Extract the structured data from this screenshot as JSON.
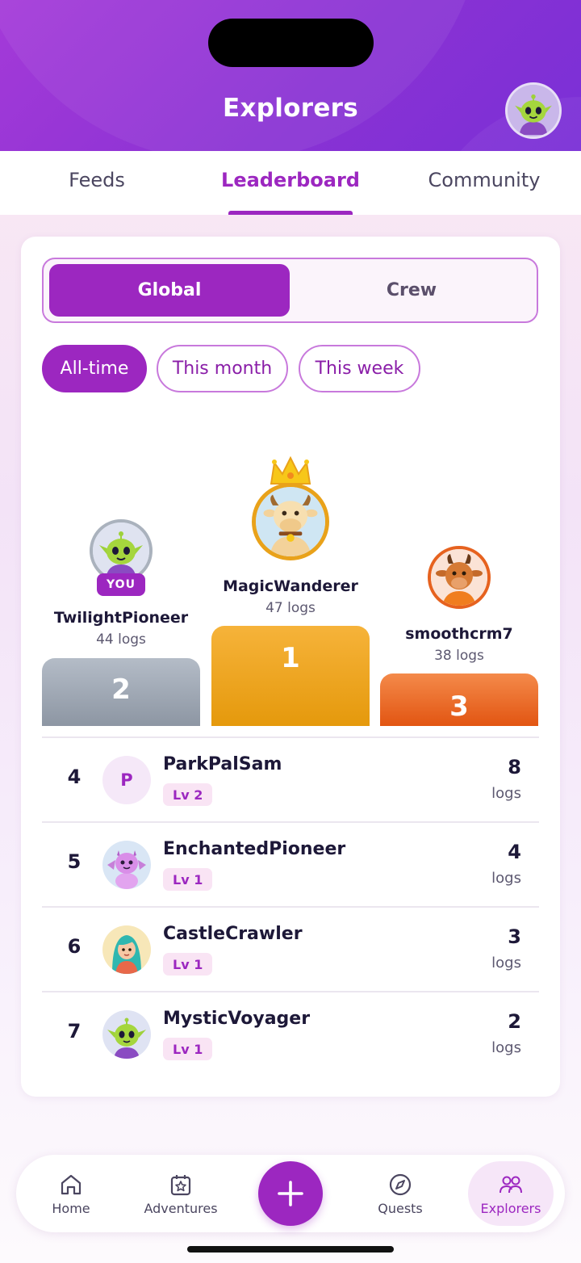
{
  "header": {
    "title": "Explorers",
    "avatar_icon": "alien-avatar-icon"
  },
  "tabs": [
    {
      "label": "Feeds",
      "active": false
    },
    {
      "label": "Leaderboard",
      "active": true
    },
    {
      "label": "Community",
      "active": false
    }
  ],
  "scope": {
    "global_label": "Global",
    "crew_label": "Crew",
    "selected": "Global"
  },
  "periods": [
    {
      "label": "All-time",
      "active": true
    },
    {
      "label": "This month",
      "active": false
    },
    {
      "label": "This week",
      "active": false
    }
  ],
  "podium": {
    "first": {
      "rank": "1",
      "name": "MagicWanderer",
      "logs": "47 logs",
      "avatar": "cow-avatar-icon",
      "crown": "crown-icon"
    },
    "second": {
      "rank": "2",
      "name": "TwilightPioneer",
      "logs": "44 logs",
      "avatar": "alien-avatar-icon",
      "badge": "YOU"
    },
    "third": {
      "rank": "3",
      "name": "smoothcrm7",
      "logs": "38 logs",
      "avatar": "goat-avatar-icon"
    }
  },
  "rows": [
    {
      "rank": "4",
      "name": "ParkPalSam",
      "level": "Lv 2",
      "count": "8",
      "unit": "logs",
      "avatar_initial": "P"
    },
    {
      "rank": "5",
      "name": "EnchantedPioneer",
      "level": "Lv 1",
      "count": "4",
      "unit": "logs",
      "avatar": "dragon-avatar-icon"
    },
    {
      "rank": "6",
      "name": "CastleCrawler",
      "level": "Lv 1",
      "count": "3",
      "unit": "logs",
      "avatar": "girl-avatar-icon"
    },
    {
      "rank": "7",
      "name": "MysticVoyager",
      "level": "Lv 1",
      "count": "2",
      "unit": "logs",
      "avatar": "alien-avatar-icon"
    }
  ],
  "nav": [
    {
      "label": "Home",
      "icon": "home-icon"
    },
    {
      "label": "Adventures",
      "icon": "calendar-star-icon"
    },
    {
      "label": "",
      "icon": "plus-icon"
    },
    {
      "label": "Quests",
      "icon": "compass-icon"
    },
    {
      "label": "Explorers",
      "icon": "people-icon",
      "active": true
    }
  ],
  "colors": {
    "brand": "#9c27c0",
    "gold": "#e9a21a",
    "silver": "#98a0ac",
    "bronze": "#e6621f"
  }
}
